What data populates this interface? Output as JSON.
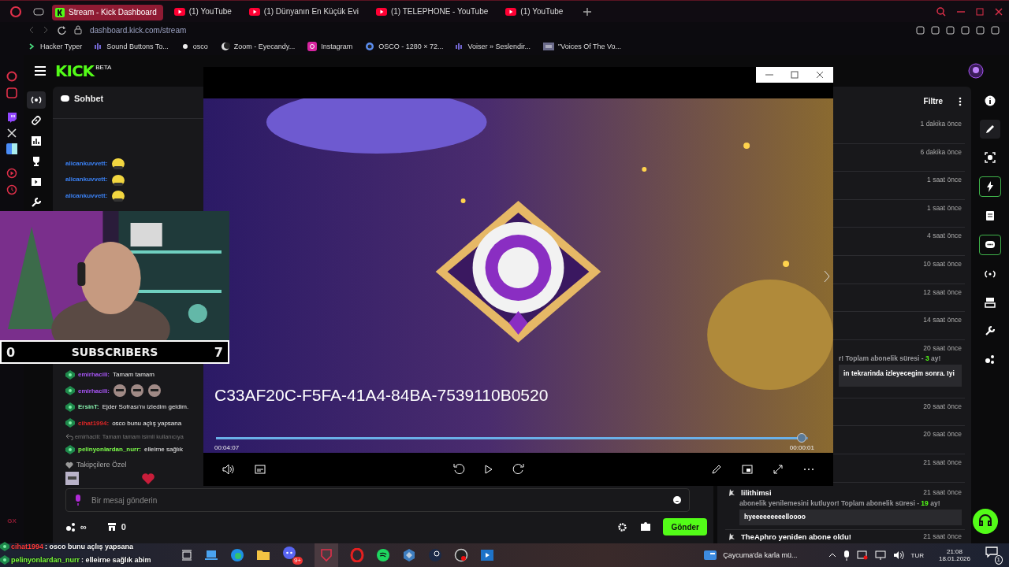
{
  "browser": {
    "tabs": [
      {
        "label": "Stream - Kick Dashboard",
        "kind": "kick",
        "selected": true
      },
      {
        "label": "(1) YouTube",
        "kind": "youtube",
        "selected": false
      },
      {
        "label": "(1) Dünyanın En Küçük Evi",
        "kind": "youtube",
        "selected": false
      },
      {
        "label": "(1) TELEPHONE - YouTube",
        "kind": "youtube",
        "selected": false
      },
      {
        "label": "(1) YouTube",
        "kind": "youtube",
        "selected": false
      }
    ],
    "url": "dashboard.kick.com/stream",
    "bookmarks": [
      {
        "label": "Hacker Typer",
        "kind": "prompt"
      },
      {
        "label": "Sound Buttons To...",
        "kind": "bars"
      },
      {
        "label": "osco",
        "kind": "dot"
      },
      {
        "label": "Zoom - Eyecandy...",
        "kind": "moon"
      },
      {
        "label": "Instagram",
        "kind": "camera"
      },
      {
        "label": "OSCO - 1280 × 72...",
        "kind": "ring"
      },
      {
        "label": "Voiser » Seslendir...",
        "kind": "bars"
      },
      {
        "label": "\"Voices Of The Vo...",
        "kind": "thumb"
      }
    ]
  },
  "side_rail": {
    "label": "GX"
  },
  "kick": {
    "logo": "KICK",
    "badge": "BETA"
  },
  "chat": {
    "title": "Sohbet",
    "earlier_messages": [
      {
        "user": "alicankuvvett:",
        "color": "#3b82f6",
        "emotes": [
          {
            "kind": "face"
          }
        ]
      },
      {
        "user": "alicankuvvett:",
        "color": "#3b82f6",
        "emotes": [
          {
            "kind": "face"
          }
        ]
      },
      {
        "user": "alicankuvvett:",
        "color": "#3b82f6",
        "emotes": [
          {
            "kind": "face"
          }
        ]
      }
    ],
    "messages": [
      {
        "kind": "message",
        "user": "emirhacili:",
        "color": "#a855f7",
        "text": "Tamam tamam"
      },
      {
        "kind": "message",
        "user": "emirhacili:",
        "color": "#a855f7",
        "emotes": [
          {
            "kind": "man"
          },
          {
            "kind": "man"
          },
          {
            "kind": "man"
          }
        ]
      },
      {
        "kind": "message",
        "user": "ErsinT:",
        "color": "#86efac",
        "text": "Ejder Sofrası'nı izledim geldim."
      },
      {
        "kind": "message",
        "user": "cihat1994:",
        "color": "#dc2626",
        "text": "osco bunu açlış yapsana"
      },
      {
        "kind": "reply",
        "text": "emirhacili: Tamam tamam isimli kullanıcıya"
      },
      {
        "kind": "message",
        "user": "pelinyonlardan_nurr:",
        "color": "#7cfc4a",
        "text": "elleirne sağlık"
      }
    ],
    "followers_only": "Takipçilere Özel",
    "input": {
      "placeholder": "Bir mesaj gönderin"
    },
    "points": "∞",
    "store_count": "0",
    "send": "Gönder"
  },
  "webcam": {
    "left_count": "0",
    "label": "SUBSCRIBERS",
    "right_count": "7"
  },
  "player": {
    "title": "C33AF20C-F5FA-41A4-84BA-7539110B0520",
    "elapsed": "00:04:07",
    "remaining": "00:00:01",
    "level": 0.99
  },
  "feed": {
    "filter": "Filtre",
    "events": [
      {
        "kind": "plain",
        "time": "1 dakika önce"
      },
      {
        "kind": "plain",
        "time": "6 dakika önce"
      },
      {
        "kind": "plain",
        "time": "1 saat önce"
      },
      {
        "kind": "plain",
        "time": "1 saat önce"
      },
      {
        "kind": "plain",
        "time": "4 saat önce"
      },
      {
        "kind": "plain",
        "time": "10 saat önce"
      },
      {
        "kind": "plain",
        "time": "12 saat önce"
      },
      {
        "kind": "plain",
        "time": "14 saat önce"
      },
      {
        "kind": "partial",
        "time": "20 saat önce",
        "note": "r! Toplam abonelik süresi - ",
        "months": "3",
        "note_end": " ay!",
        "message": "in tekrarinda izleyecegim sonra. Iyi"
      },
      {
        "kind": "plain",
        "time": "20 saat önce"
      },
      {
        "kind": "plain",
        "time": "20 saat önce"
      },
      {
        "kind": "plain",
        "time": "21 saat önce"
      },
      {
        "kind": "full",
        "user": "lilithimsi",
        "time": "21 saat önce",
        "note": "abonelik yenilemesini kutluyor! Toplam abonelik süresi - ",
        "months": "19",
        "note_end": " ay!",
        "message": "hyeeeeeeeeelloooo"
      },
      {
        "kind": "title",
        "title": "TheAphro yeniden abone oldu!",
        "time": "21 saat önce"
      }
    ]
  },
  "stream_overlay": [
    {
      "user": "cihat1994",
      "color": "#ff3b3b",
      "text": ": osco bunu açlış yapsana"
    },
    {
      "user": "pelinyonlardan_nurr",
      "color": "#7cff3b",
      "text": ": elleirne sağlık abim"
    }
  ],
  "taskbar": {
    "discord_badge": "9+",
    "news": "Çaycuma'da karla mü...",
    "lang": "TUR",
    "time": "21:08",
    "date": "18.01.2026",
    "notifications": "1"
  }
}
